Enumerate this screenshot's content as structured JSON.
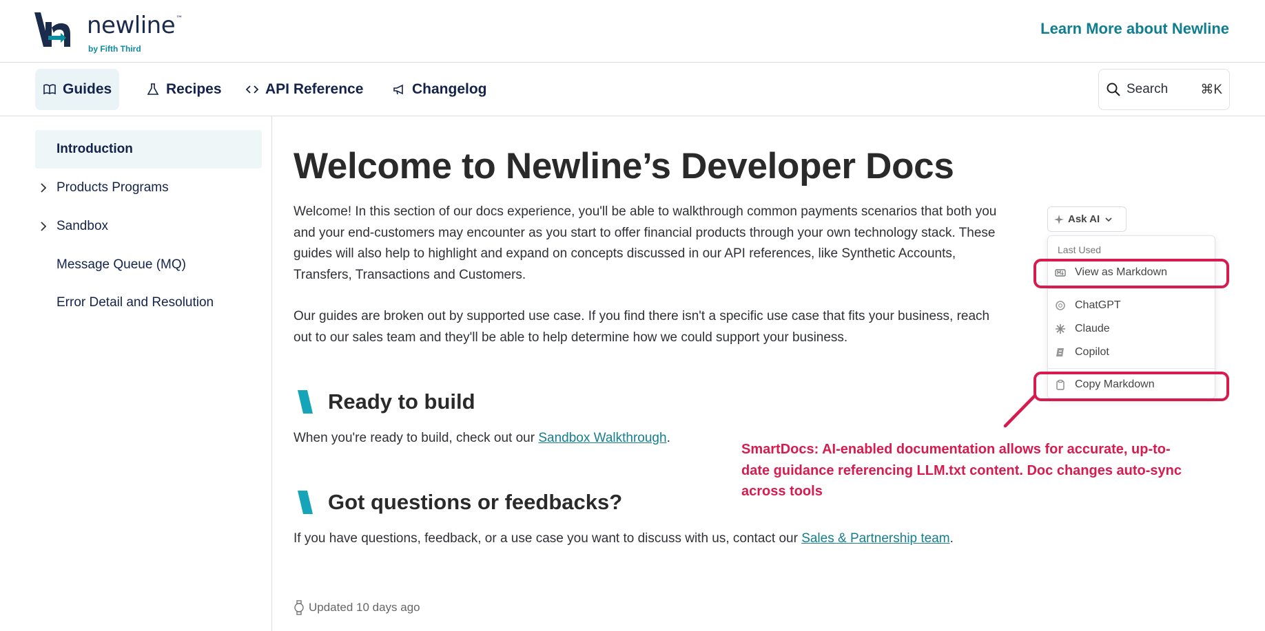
{
  "header": {
    "logo_word": "newline",
    "logo_tm": "™",
    "logo_sub": "by Fifth Third",
    "learn_more": "Learn More about Newline"
  },
  "nav": {
    "tabs": [
      {
        "label": "Guides",
        "icon": "book-icon",
        "active": true
      },
      {
        "label": "Recipes",
        "icon": "flask-icon"
      },
      {
        "label": "API Reference",
        "icon": "code-icon"
      },
      {
        "label": "Changelog",
        "icon": "megaphone-icon"
      }
    ],
    "search_label": "Search",
    "search_shortcut": "⌘K"
  },
  "sidebar": {
    "items": [
      {
        "label": "Introduction",
        "active": true
      },
      {
        "label": "Products Programs",
        "expandable": true
      },
      {
        "label": "Sandbox",
        "expandable": true
      },
      {
        "label": "Message Queue (MQ)"
      },
      {
        "label": "Error Detail and Resolution"
      }
    ]
  },
  "main": {
    "title": "Welcome to Newline’s Developer Docs",
    "intro_1": "Welcome! In this section of our docs experience, you'll be able to walkthrough common payments scenarios that both you and your end-customers may encounter as you start to offer financial products through your own technology stack. These guides will also help to highlight and expand on concepts discussed in our API references, like Synthetic Accounts, Transfers, Transactions and Customers.",
    "intro_2": "Our guides are broken out by supported use case. If you find there isn't a specific use case that fits your business, reach out to our sales team and they'll be able to help determine how we could support your business.",
    "section_build": {
      "heading": "Ready to build",
      "text_before": "When you're ready to build, check out our ",
      "link": "Sandbox Walkthrough",
      "text_after": "."
    },
    "section_questions": {
      "heading": "Got questions or feedbacks?",
      "text_before": "If you have questions, feedback, or a use case you want to discuss with us, contact our ",
      "link": "Sales & Partnership team",
      "text_after": "."
    },
    "updated": "Updated 10 days ago"
  },
  "ask_ai": {
    "button_label": "Ask AI",
    "menu_header": "Last Used",
    "items": [
      {
        "label": "View as Markdown",
        "icon": "markdown-icon"
      },
      {
        "label": "ChatGPT",
        "icon": "chatgpt-icon"
      },
      {
        "label": "Claude",
        "icon": "claude-icon"
      },
      {
        "label": "Copilot",
        "icon": "copilot-icon"
      },
      {
        "label": "Copy Markdown",
        "icon": "clipboard-icon"
      }
    ]
  },
  "annotation": {
    "text": "SmartDocs: AI-enabled documentation allows for accurate, up-to-date guidance referencing LLM.txt content. Doc changes auto-sync across tools",
    "color": "#d81b4f"
  },
  "colors": {
    "accent": "#0f7e8e",
    "navy": "#14234a",
    "highlight": "#d81b4f"
  }
}
